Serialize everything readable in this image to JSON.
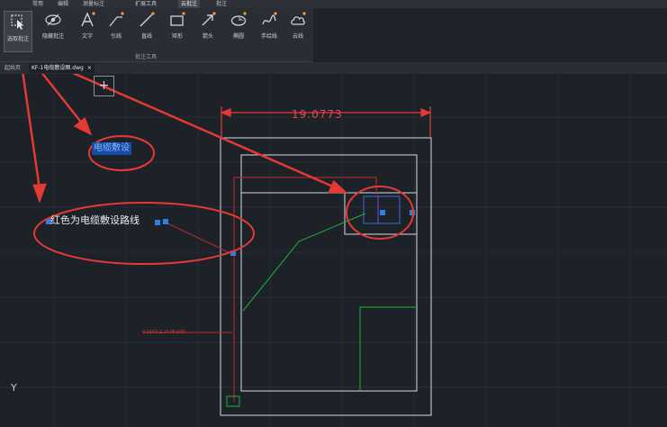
{
  "menu": {
    "items": [
      "常用",
      "编辑",
      "测量标注",
      "扩展工具",
      "云批注",
      "批注"
    ]
  },
  "ribbon": {
    "tools": [
      {
        "label": "选取批注",
        "icon": "select-cursor-icon"
      },
      {
        "label": "隐藏批注",
        "icon": "hide-eye-icon"
      },
      {
        "label": "文字",
        "icon": "text-icon"
      },
      {
        "label": "引线",
        "icon": "leader-line-icon"
      },
      {
        "label": "直线",
        "icon": "line-icon"
      },
      {
        "label": "矩形",
        "icon": "rectangle-icon"
      },
      {
        "label": "箭头",
        "icon": "arrow-icon"
      },
      {
        "label": "椭圆",
        "icon": "ellipse-icon"
      },
      {
        "label": "手绘线",
        "icon": "freehand-icon"
      },
      {
        "label": "云线",
        "icon": "cloud-icon"
      }
    ],
    "group_title": "批注工具"
  },
  "tabs": {
    "start": "起始页",
    "file": "KF-1电缆敷设图.dwg",
    "close": "×",
    "plus": "+"
  },
  "drawing": {
    "dimension": "19.0773",
    "selected_annotation": "电缆敷设",
    "route_label": "红色为电缆敷设路线",
    "coord_label": "0.2153,1.2148,000",
    "axis_y": "Y"
  },
  "colors": {
    "background": "#1d2128",
    "annotation_red": "#e53935",
    "cable_green": "#1fae3b",
    "outline_white": "#d9dcdf",
    "grip_blue": "#2f7fe0"
  }
}
